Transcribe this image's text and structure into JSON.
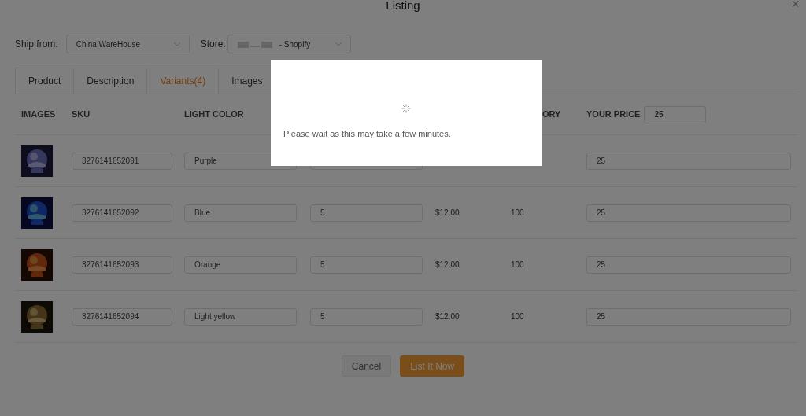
{
  "dialog": {
    "title": "Listing",
    "close": "×"
  },
  "ship_from": {
    "label": "Ship from:",
    "value": "China WareHouse"
  },
  "store": {
    "label": "Store:",
    "value": "- Shopify"
  },
  "tabs": [
    {
      "label": "Product",
      "selected": false
    },
    {
      "label": "Description",
      "selected": false
    },
    {
      "label": "Variants(4)",
      "selected": true
    },
    {
      "label": "Images",
      "selected": false
    }
  ],
  "table": {
    "columns": [
      "IMAGES",
      "SKU",
      "LIGHT COLOR",
      "ORY",
      "YOUR PRICE"
    ],
    "price_all": "25",
    "rows": [
      {
        "sku": "3276141652091",
        "light_color": "Purple",
        "price": "25"
      },
      {
        "sku": "3276141652092",
        "light_color": "Blue",
        "quantity": "5",
        "cost": "$12.00",
        "inventory": "100",
        "price": "25"
      },
      {
        "sku": "3276141652093",
        "light_color": "Orange",
        "quantity": "5",
        "cost": "$12.00",
        "inventory": "100",
        "price": "25"
      },
      {
        "sku": "3276141652094",
        "light_color": "Light yellow",
        "quantity": "5",
        "cost": "$12.00",
        "inventory": "100",
        "price": "25"
      }
    ]
  },
  "buttons": [
    {
      "label": "Cancel",
      "kind": "secondary"
    },
    {
      "label": "List It Now",
      "kind": "primary"
    }
  ],
  "loading": {
    "message": "Please wait as this may take a few minutes."
  }
}
